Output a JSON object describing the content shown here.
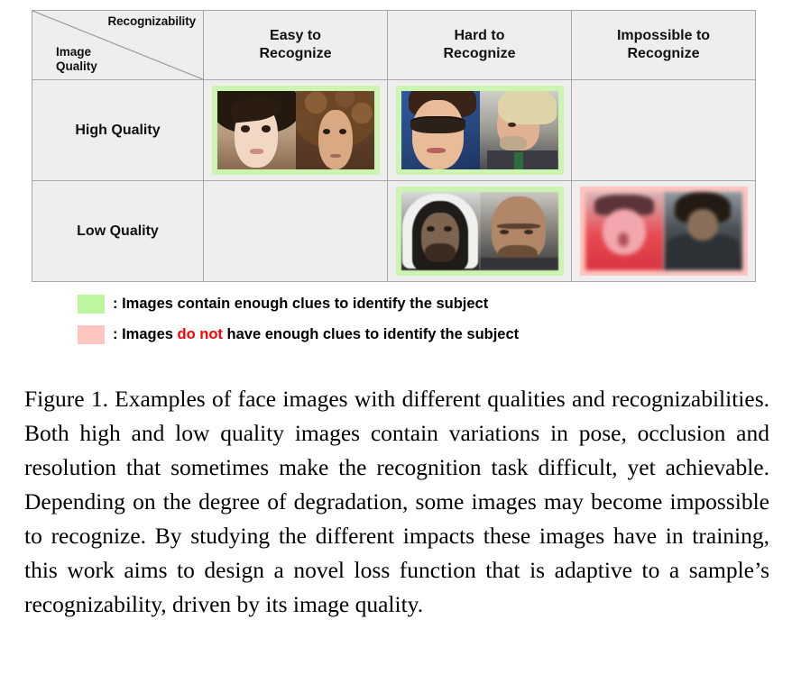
{
  "figure": {
    "table": {
      "corner": {
        "recognizability_label": "Recognizability",
        "quality_label_line1": "Image",
        "quality_label_line2": "Quality"
      },
      "column_headers": [
        {
          "line1": "Easy to",
          "line2": "Recognize"
        },
        {
          "line1": "Hard to",
          "line2": "Recognize"
        },
        {
          "line1": "Impossible to",
          "line2": "Recognize"
        }
      ],
      "row_headers": [
        "High Quality",
        "Low Quality"
      ],
      "cells": [
        {
          "row": "High Quality",
          "column": "Easy to Recognize",
          "state": "filled",
          "frame": "green",
          "images": [
            "face-asian-woman-smiling",
            "face-curly-hair-woman"
          ]
        },
        {
          "row": "High Quality",
          "column": "Hard to Recognize",
          "state": "filled",
          "frame": "green",
          "images": [
            "face-woman-sunglasses",
            "face-blond-man-profile"
          ]
        },
        {
          "row": "High Quality",
          "column": "Impossible to Recognize",
          "state": "empty",
          "frame": "none",
          "images": []
        },
        {
          "row": "Low Quality",
          "column": "Easy to Recognize",
          "state": "empty",
          "frame": "none",
          "images": []
        },
        {
          "row": "Low Quality",
          "column": "Hard to Recognize",
          "state": "filled",
          "frame": "green",
          "images": [
            "face-hooded-man-lowres",
            "face-bald-man-lowres"
          ]
        },
        {
          "row": "Low Quality",
          "column": "Impossible to Recognize",
          "state": "filled",
          "frame": "pink",
          "images": [
            "face-red-blur-unrecognizable",
            "face-dark-blur-unrecognizable"
          ]
        }
      ]
    },
    "legend": [
      {
        "swatch": "green",
        "swatch_color": "#bcf7a0",
        "text_before": ": Images contain enough clues to identify the subject",
        "emphasis": "",
        "text_after": ""
      },
      {
        "swatch": "pink",
        "swatch_color": "#ffc6c1",
        "text_before": ": Images ",
        "emphasis": "do not",
        "emphasis_color": "#ff0000",
        "text_after": " have enough clues to identify the subject"
      }
    ],
    "caption": {
      "lead": "Figure 1.",
      "body": "Examples of face images with different qualities and recognizabilities. Both high and low quality images contain variations in pose, occlusion and resolution that sometimes make the recognition task difficult, yet achievable. Depending on the degree of degradation, some images may become impossible to recognize. By studying the different impacts these images have in training, this work aims to design a novel loss function that is adaptive to a sample’s recognizability, driven by its image quality."
    }
  }
}
